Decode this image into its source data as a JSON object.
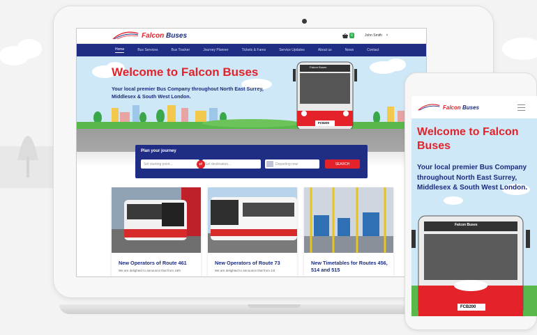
{
  "site": {
    "logo_text_a": "Falcon",
    "logo_text_b": "Buses",
    "cart_count": "0",
    "user_name": "John Smith",
    "user_caret": "˅"
  },
  "nav": {
    "items": [
      "Home",
      "Bus Services",
      "Bus Tracker",
      "Journey Planner",
      "Tickets & Fares",
      "Service Updates",
      "About us",
      "News",
      "Contact"
    ]
  },
  "hero": {
    "title": "Welcome to Falcon Buses",
    "subtitle": "Your local premier Bus Company throughout North East Surrey, Middlesex & South West London.",
    "bus_header": "Falcon Buses",
    "bus_plate": "FC8200"
  },
  "planner": {
    "title": "Plan your journey",
    "start_placeholder": "Set starting point...",
    "dest_placeholder": "Set destination...",
    "depart_value": "Departing now",
    "search_label": "SEARCH"
  },
  "news": [
    {
      "title": "New Operators of Route 461",
      "desc": "We are delighted to announce that from 15th"
    },
    {
      "title": "New Operators of Route 73",
      "desc": "We are delighted to announce that from 1st"
    },
    {
      "title": "New Timetables for Routes 456, 514 and 515",
      "desc": ""
    }
  ],
  "mobile": {
    "title": "Welcome to Falcon Buses",
    "subtitle": "Your local premier Bus Company throughout North East Surrey, Middlesex & South West London.",
    "bus_header": "Falcon Buses",
    "bus_plate": "FCB200"
  },
  "colors": {
    "brand_red": "#e3222a",
    "brand_blue": "#1f2d85"
  }
}
